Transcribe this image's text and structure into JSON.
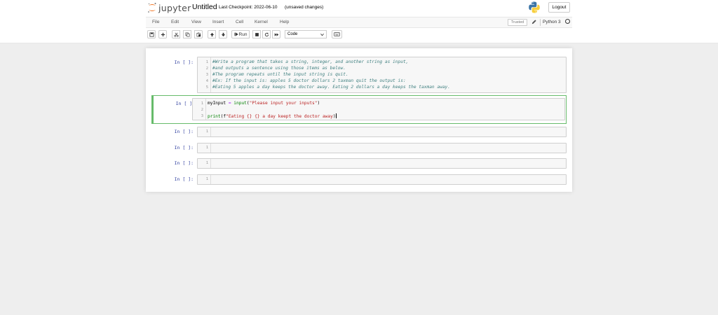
{
  "header": {
    "logo_text": "jupyter",
    "notebook_title": "Untitled",
    "checkpoint": "Last Checkpoint: 2022-06-10",
    "autosave": "(unsaved changes)",
    "logout_label": "Logout"
  },
  "menu": [
    "File",
    "Edit",
    "View",
    "Insert",
    "Cell",
    "Kernel",
    "Help"
  ],
  "kernel": {
    "trusted_label": "Trusted",
    "name": "Python 3"
  },
  "toolbar": {
    "run_label": "Run",
    "cell_type": "Code"
  },
  "cells": [
    {
      "prompt": "In [ ]:",
      "lines": [
        "#Write a program that takes a string, integer, and another string as input,",
        "#and outputs a sentence using those items as below.",
        "#The program repeats until the input string is quit.",
        "#Ex: If the input is: apples 5 doctor dollars 2 taxman quit the output is:",
        "#Eating 5 apples a day keeps the doctor away. Eating 2 dollars a day keeps the taxman away."
      ],
      "line_numbers": [
        "1",
        "2",
        "3",
        "4",
        "5"
      ]
    },
    {
      "prompt": "In [ ]:",
      "line_numbers": [
        "1",
        "2",
        "3"
      ],
      "line1": {
        "var": "myInput",
        "op": "=",
        "fn": "input",
        "arg": "\"Please input your inputs\""
      },
      "line3": {
        "fn": "print",
        "prefix": "f",
        "arg": "\"Eating {} {} a day keept the doctor away"
      }
    },
    {
      "prompt": "In [ ]:",
      "line_numbers": [
        "1"
      ]
    },
    {
      "prompt": "In [ ]:",
      "line_numbers": [
        "1"
      ]
    },
    {
      "prompt": "In [ ]:",
      "line_numbers": [
        "1"
      ]
    },
    {
      "prompt": "In [ ]:",
      "line_numbers": [
        "1"
      ]
    }
  ]
}
